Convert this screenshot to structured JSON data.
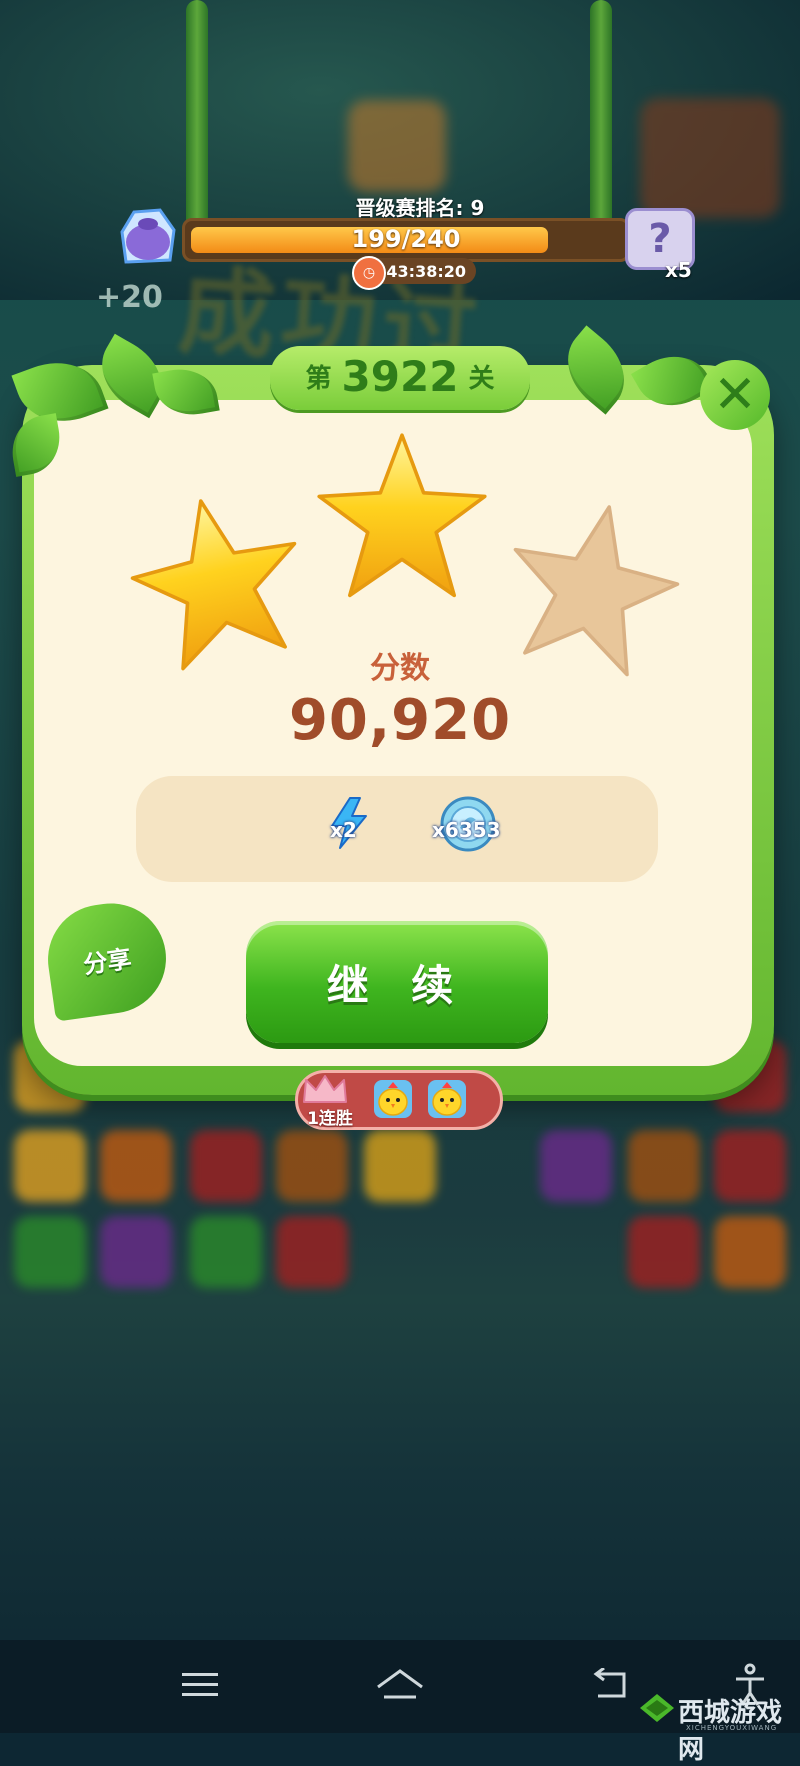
{
  "hud": {
    "rank_label": "晋级赛排名: 9",
    "progress_text": "199/240",
    "progress_value": 199,
    "progress_max": 240,
    "timer": "43:38:20",
    "bag_bonus": "+20",
    "puzzle_count": "x5"
  },
  "background": {
    "banner_text": "成功过关!!"
  },
  "dialog": {
    "level_prefix": "第",
    "level_number": "3922",
    "level_suffix": "关",
    "stars_earned": 2,
    "stars_total": 3,
    "score_label": "分数",
    "score_value": "90,920",
    "rewards": [
      {
        "icon": "lightning-icon",
        "count": "x2"
      },
      {
        "icon": "coin-icon",
        "count": "x6353"
      }
    ],
    "continue_label": "继 续",
    "share_label": "分享",
    "streak_label": "1连胜",
    "streak_chicks": 2
  },
  "colors": {
    "dialog_green": "#62b62f",
    "panel_cream": "#fdf5df",
    "score_brown": "#a04c2a",
    "progress_orange": "#f38b16",
    "streak_red": "#c04a46"
  },
  "watermark": {
    "main": "西城游戏网",
    "sub": "XICHENGYOUXIWANG"
  }
}
